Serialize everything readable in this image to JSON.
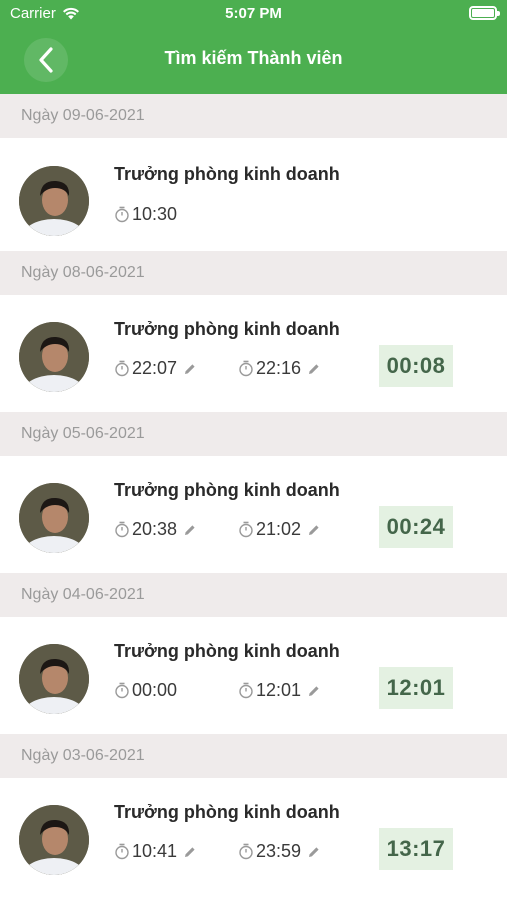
{
  "status_bar": {
    "carrier": "Carrier",
    "time": "5:07 PM"
  },
  "nav": {
    "title": "Tìm kiếm Thành viên"
  },
  "groups": [
    {
      "date": "Ngày 09-06-2021",
      "name": "Trưởng phòng kinh doanh",
      "check_in": "10:30",
      "check_out": "",
      "duration": ""
    },
    {
      "date": "Ngày 08-06-2021",
      "name": "Trưởng phòng kinh doanh",
      "check_in": "22:07",
      "check_out": "22:16",
      "duration": "00:08"
    },
    {
      "date": "Ngày 05-06-2021",
      "name": "Trưởng phòng kinh doanh",
      "check_in": "20:38",
      "check_out": "21:02",
      "duration": "00:24"
    },
    {
      "date": "Ngày 04-06-2021",
      "name": "Trưởng phòng kinh doanh",
      "check_in": "00:00",
      "check_out": "12:01",
      "duration": "12:01"
    },
    {
      "date": "Ngày 03-06-2021",
      "name": "Trưởng phòng kinh doanh",
      "check_in": "10:41",
      "check_out": "23:59",
      "duration": "13:17"
    }
  ],
  "colors": {
    "accent": "#4caf50",
    "duration_bg": "#e4f1e2",
    "header_bg": "#efebeb"
  }
}
